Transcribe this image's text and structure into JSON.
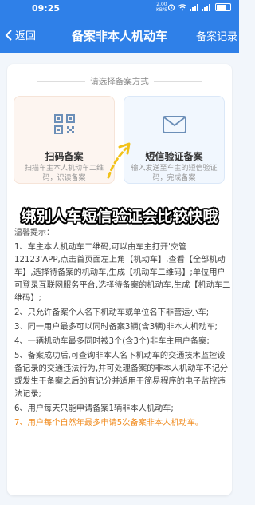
{
  "status_bar": {
    "time": "09:25",
    "net_speed": "2.00",
    "net_unit": "KB/S"
  },
  "header": {
    "back_label": "返回",
    "title": "备案非本人机动车",
    "right_label": "备案记录"
  },
  "selection": {
    "title": "请选择备案方式",
    "options": [
      {
        "icon": "qr-code-icon",
        "label": "扫码备案",
        "desc": "扫描车主本人机动车二维码，识读备案"
      },
      {
        "icon": "envelope-icon",
        "label": "短信验证备案",
        "desc": "输入发送至车主的短信验证码，完成备案"
      }
    ]
  },
  "overlay_caption": "绑别人车短信验证会比较快哦",
  "tips": {
    "heading": "温馨提示：",
    "items": [
      "1、车主本人机动车二维码,可以由车主打开'交管12123'APP,点击首页面左上角【机动车】,查看【全部机动车】,选择待备案的机动车,生成【机动车二维码】;单位用户可登录互联网服务平台,选择待备案的机动车,生成【机动车二维码】;",
      "2、只允许备案个人名下机动车或单位名下非营运小车;",
      "3、同一用户最多可以同时备案3辆(含3辆)非本人机动车;",
      "4、一辆机动车最多同时被3个(含3个)非车主用户备案;",
      "5、备案成功后,可查询非本人名下机动车的交通技术监控设备记录的交通违法行为,并可处理备案的非本人机动车不记分或发生于备案之后的有记分并适用于简易程序的电子监控违法记录;",
      "6、用户每天只能申请备案1辆非本人机动车;",
      "7、用户每个自然年最多申请5次备案非本人机动车。"
    ]
  },
  "colors": {
    "primary": "#2f80e8",
    "highlight": "#f08a1c"
  }
}
